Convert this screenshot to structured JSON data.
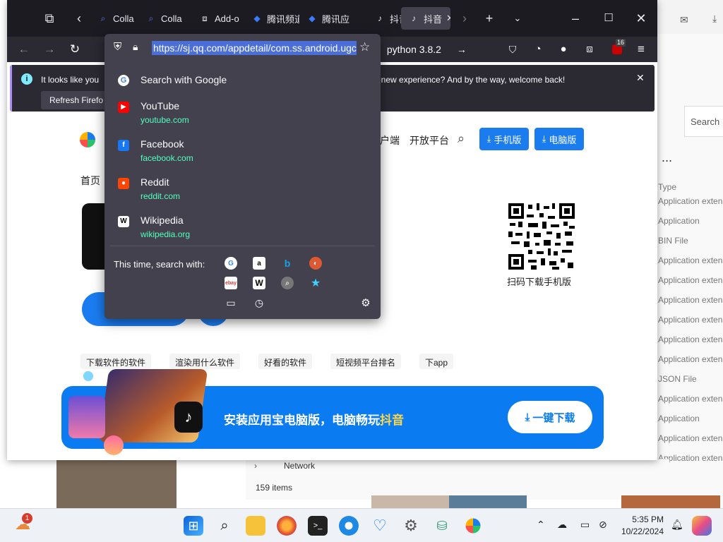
{
  "tabs": [
    {
      "label": "Colla",
      "icon": "search-icon"
    },
    {
      "label": "Colla",
      "icon": "search-icon"
    },
    {
      "label": "Add-o",
      "icon": "puzzle-icon"
    },
    {
      "label": "腾讯频道",
      "icon": "tencent-icon"
    },
    {
      "label": "腾讯应",
      "icon": "tencent-icon"
    },
    {
      "label": "抖音A",
      "icon": "douyin-icon"
    },
    {
      "label": "抖音",
      "icon": "douyin-icon",
      "selected": true
    }
  ],
  "url": "https://sj.qq.com/appdetail/com.ss.android.ugc.aweme",
  "secondary_search": "python 3.8.2",
  "extension_badge": "16",
  "notice": {
    "message_left": "It looks like you",
    "message_right": "e-new experience? And by the way, welcome back!",
    "refresh_button": "Refresh Firefo"
  },
  "dropdown": {
    "first_item": "Search with Google",
    "shortcuts": [
      {
        "title": "YouTube",
        "url": "youtube.com",
        "color": "#ff0000"
      },
      {
        "title": "Facebook",
        "url": "facebook.com",
        "color": "#1877f2"
      },
      {
        "title": "Reddit",
        "url": "reddit.com",
        "color": "#ff4500"
      },
      {
        "title": "Wikipedia",
        "url": "wikipedia.org",
        "color": "#ffffff"
      }
    ],
    "this_time_label": "This time, search with:"
  },
  "page": {
    "nav_items": [
      "首页",
      "客户端",
      "开放平台"
    ],
    "mobile_button": "手机版",
    "pc_button": "电脑版",
    "qr_caption": "扫码下载手机版",
    "tags": [
      "下载软件的软件",
      "渲染用什么软件",
      "好看的软件",
      "短视频平台排名",
      "下app"
    ],
    "banner_text_prefix": "安装应用宝电脑版，电脑畅玩",
    "banner_text_highlight": "抖音",
    "banner_button": "一键下载"
  },
  "explorer": {
    "search_placeholder": "Search",
    "more": "...",
    "column_header": "Type",
    "rows": [
      "Application extens",
      "Application",
      "BIN File",
      "Application extens",
      "Application extens",
      "Application extens",
      "Application extens",
      "Application extens",
      "Application extens",
      "JSON File",
      "Application extens",
      "Application",
      "Application extens",
      "Application extens"
    ],
    "network_label": "Network",
    "item_count": "159 items"
  },
  "taskbar": {
    "weather_badge": "1",
    "time": "5:35 PM",
    "date": "10/22/2024"
  }
}
